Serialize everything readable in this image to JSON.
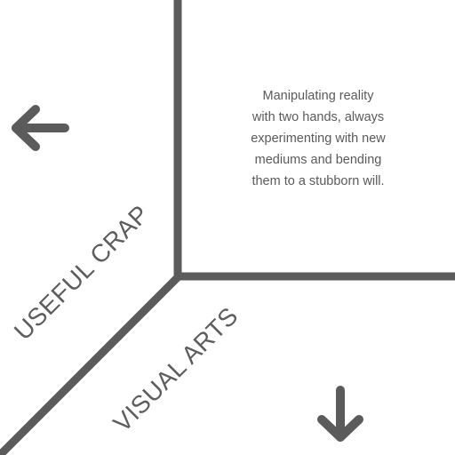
{
  "description": {
    "lines": [
      "Manipulating reality",
      "with two hands, always",
      "experimenting with new",
      "mediums and bending",
      "them to a stubborn will."
    ]
  },
  "sections": {
    "left_label": "USEFUL CRAP",
    "bottom_label": "VISUAL ARTS"
  },
  "icons": {
    "left_arrow": "arrow-left-icon",
    "down_arrow": "arrow-down-icon"
  },
  "colors": {
    "divider": "#5b5b5b",
    "text": "#5a5a5a",
    "background": "#ffffff"
  }
}
